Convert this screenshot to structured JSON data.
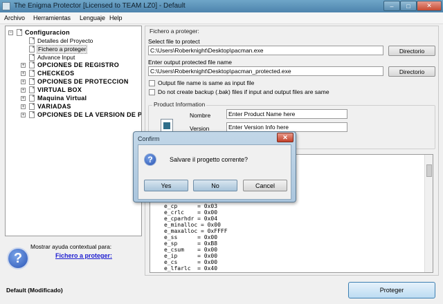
{
  "window": {
    "title": "The Enigma Protector [Licensed to TEAM LZ0] - Default",
    "controls": {
      "minimize": "–",
      "maximize": "□",
      "close": "✕"
    }
  },
  "menu": [
    "Archivo",
    "Herramientas",
    "Lenguaje",
    "Help"
  ],
  "tree": [
    {
      "label": "Configuracion",
      "expander": "−",
      "level": 0,
      "style": "bold"
    },
    {
      "label": "Detalles del Proyecto",
      "level": 1
    },
    {
      "label": "Fichero a proteger",
      "level": 1,
      "selected": true
    },
    {
      "label": "Advance Input",
      "level": 1
    },
    {
      "label": "OPCIONES DE REGISTRO",
      "expander": "+",
      "level": 1,
      "style": "bold"
    },
    {
      "label": "CHECKEOS",
      "expander": "+",
      "level": 1,
      "style": "bold"
    },
    {
      "label": "OPCIONES DE PROTECCION",
      "expander": "+",
      "level": 1,
      "style": "bold"
    },
    {
      "label": "VIRTUAL BOX",
      "expander": "+",
      "level": 1,
      "style": "bold"
    },
    {
      "label": "Maquina Virtual",
      "expander": "+",
      "level": 1,
      "style": "bold"
    },
    {
      "label": "VARIADAS",
      "expander": "+",
      "level": 1,
      "style": "bold"
    },
    {
      "label": "OPCIONES DE LA VERSION DE PF",
      "expander": "+",
      "level": 1,
      "style": "bold"
    }
  ],
  "help": {
    "text": "Mostrar ayuda contextual para:",
    "link": "Fichero a proteger:"
  },
  "protect": {
    "group_title": "Fichero a proteger:",
    "input_label": "Select file to protect",
    "input_value": "C:\\Users\\Roberknight\\Desktop\\pacman.exe",
    "output_label": "Enter output protected file name",
    "output_value": "C:\\Users\\Roberknight\\Desktop\\pacman_protected.exe",
    "browse_label": "Directorio",
    "checkbox_same": "Output file name is same as input file",
    "checkbox_backup": "Do not create backup (.bak) files if input and output files are same"
  },
  "product": {
    "group_title": "Product Information",
    "name_label": "Nombre",
    "name_value": "Enter Product Name here",
    "version_label": "Version",
    "version_value": "Enter Version Info here"
  },
  "code_lines": [
    "e_cp      = 0x03",
    "e_crlc    = 0x00",
    "e_cparhdr = 0x04",
    "e_minalloc = 0x00",
    "e_maxalloc = 0xFFFF",
    "e_ss      = 0x00",
    "e_sp      = 0xB8",
    "e_csum    = 0x00",
    "e_ip      = 0x00",
    "e_cs      = 0x00",
    "e_lfarlc  = 0x40"
  ],
  "status": "Default  (Modificado)",
  "protect_button": "Proteger",
  "dialog": {
    "title": "Confirm",
    "message": "Salvare il progetto corrente?",
    "yes": "Yes",
    "no": "No",
    "cancel": "Cancel",
    "close": "✕"
  },
  "colors": {
    "title_bar": "#4d83ad",
    "close_red": "#c74a32",
    "link_blue": "#1a1ad0"
  }
}
